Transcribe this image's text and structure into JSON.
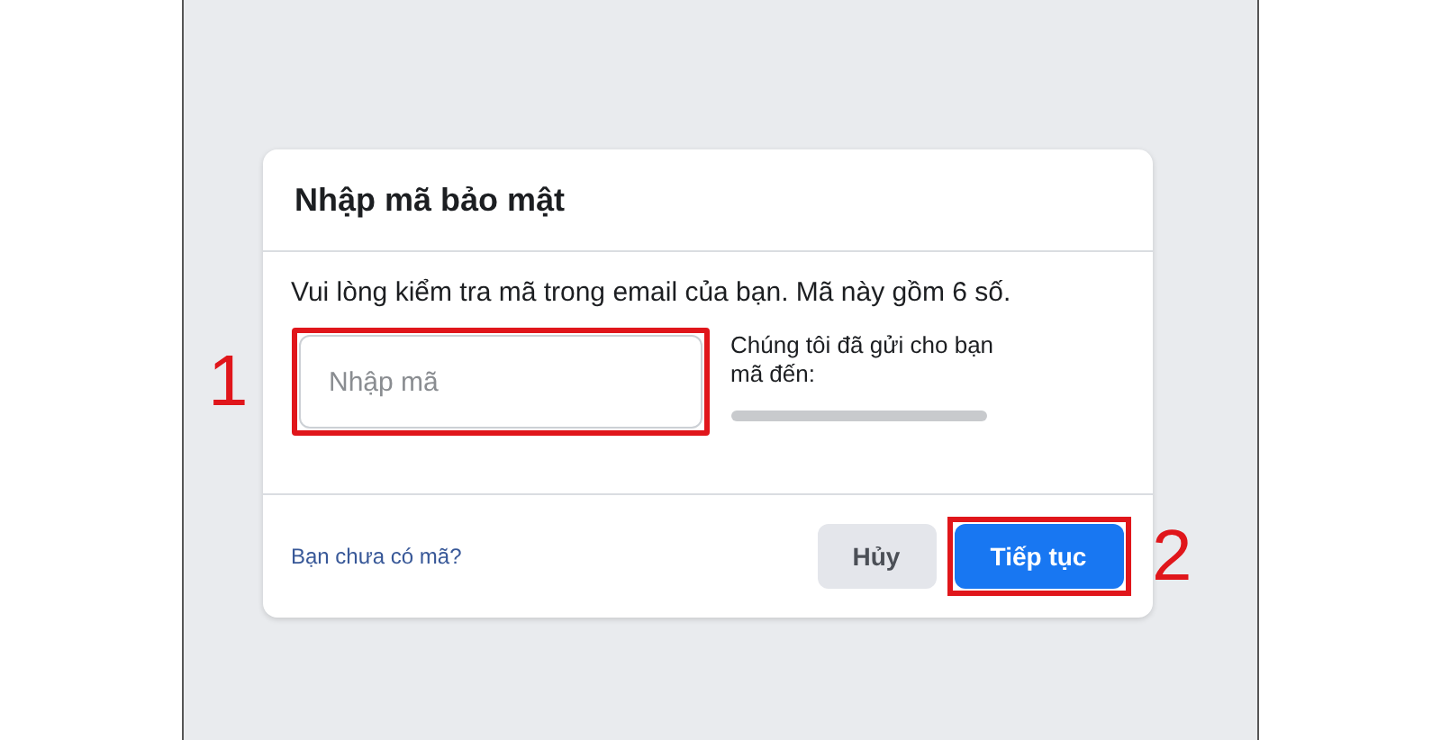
{
  "dialog": {
    "title": "Nhập mã bảo mật",
    "message": "Vui lòng kiểm tra mã trong email của bạn. Mã này gồm 6 số.",
    "code_field": {
      "placeholder": "Nhập mã"
    },
    "sent_note": "Chúng tôi đã gửi cho bạn mã đến:",
    "no_code_link": "Bạn chưa có mã?",
    "buttons": [
      {
        "label": "Hủy",
        "kind": "secondary"
      },
      {
        "label": "Tiếp tục",
        "kind": "primary"
      }
    ]
  },
  "annotations": [
    "1",
    "2"
  ]
}
